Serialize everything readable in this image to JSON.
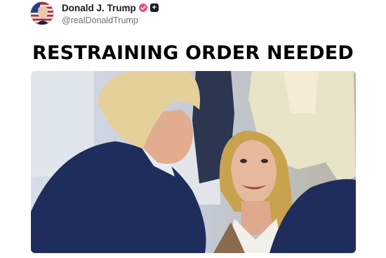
{
  "post": {
    "author": {
      "display_name": "Donald J. Trump",
      "handle": "@realDonaldTrump",
      "verified_icon": "verified-badge-icon",
      "plus_icon": "plus-icon"
    },
    "headline": "RESTRAINING ORDER NEEDED",
    "image": {
      "alt": "photo",
      "colors": {
        "accent": "#e6508a",
        "suit": "#1f2d5c",
        "background": "#c9d3df"
      }
    }
  }
}
